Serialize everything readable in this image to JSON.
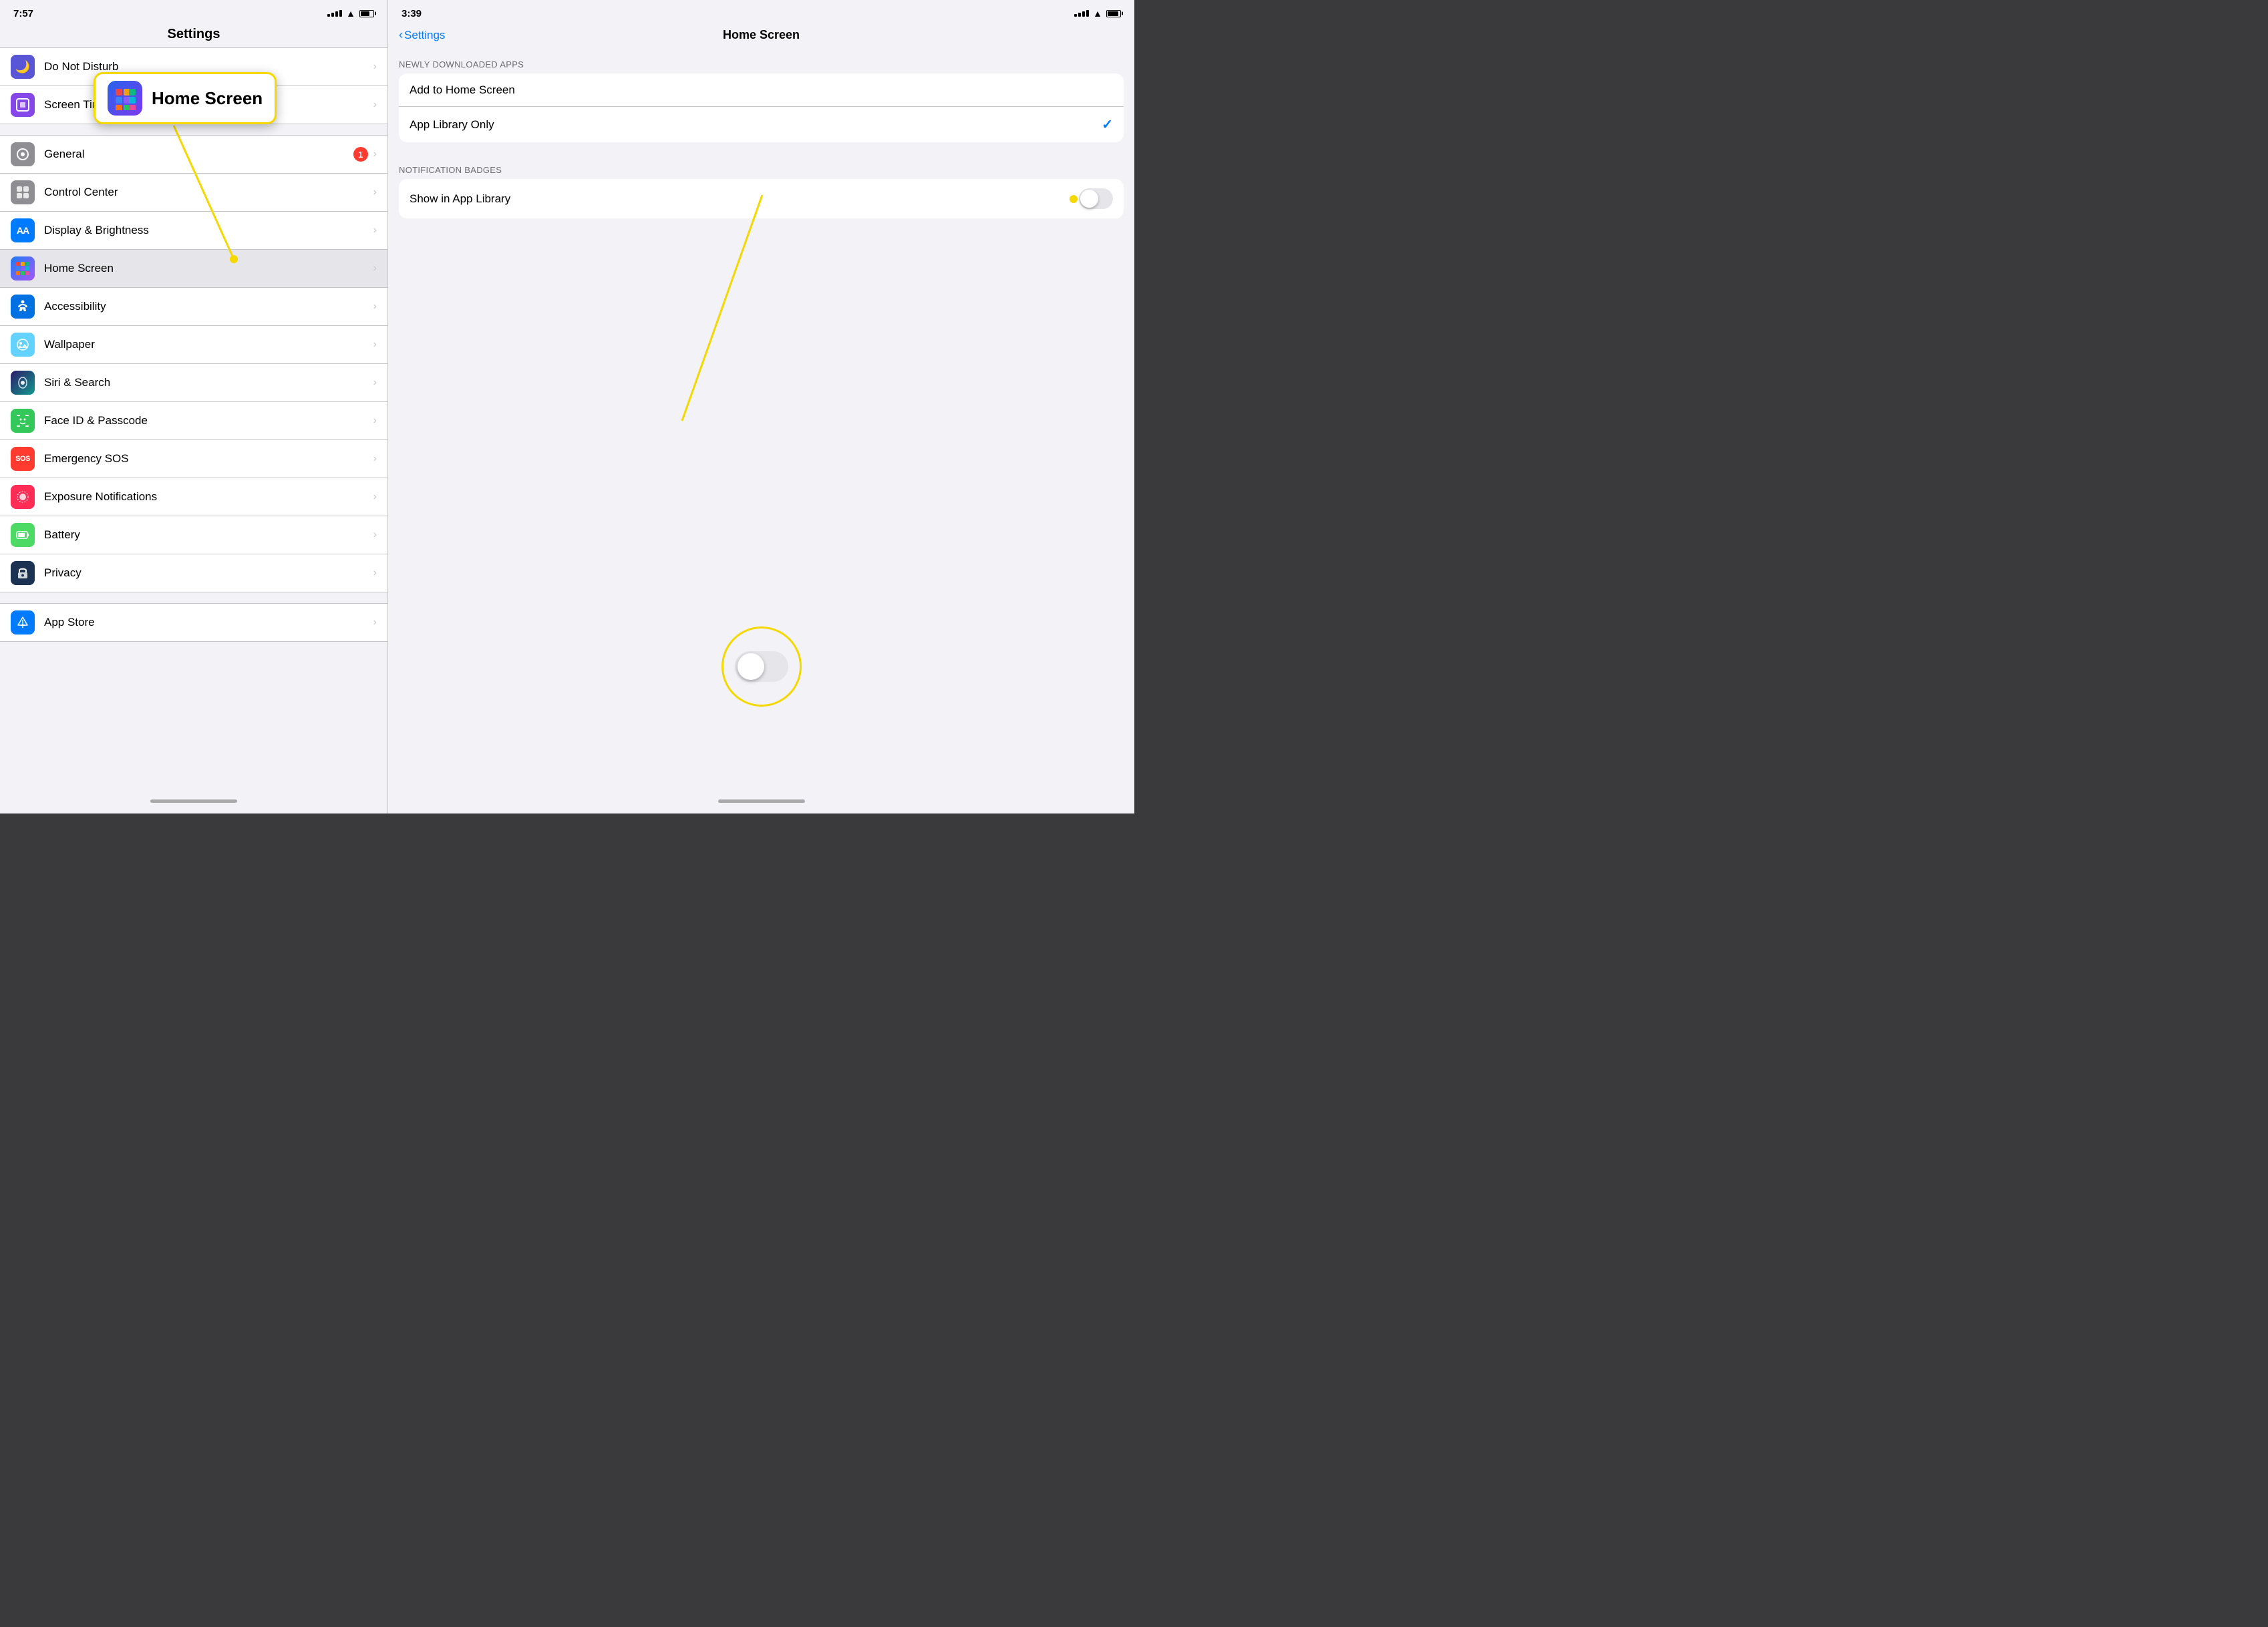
{
  "leftPanel": {
    "statusBar": {
      "time": "7:57",
      "timeIcon": "location-arrow",
      "batteryLevel": 70
    },
    "title": "Settings",
    "items": [
      {
        "id": "do-not-disturb",
        "label": "Do Not Disturb",
        "iconBg": "icon-donotdisturb",
        "iconChar": "🌙",
        "badge": null
      },
      {
        "id": "screen-time",
        "label": "Screen Time",
        "iconBg": "icon-screentime",
        "iconChar": "⏳",
        "badge": null
      },
      {
        "id": "general",
        "label": "General",
        "iconBg": "icon-general",
        "iconChar": "⚙️",
        "badge": "1"
      },
      {
        "id": "control-center",
        "label": "Control Center",
        "iconBg": "icon-controlcenter",
        "iconChar": "⊞",
        "badge": null
      },
      {
        "id": "display-brightness",
        "label": "Display & Brightness",
        "iconBg": "icon-displaybrightness",
        "iconChar": "AA",
        "badge": null
      },
      {
        "id": "home-screen",
        "label": "Home Screen",
        "iconBg": "icon-homescreen",
        "iconChar": "⊞",
        "badge": null,
        "highlighted": true
      },
      {
        "id": "accessibility",
        "label": "Accessibility",
        "iconBg": "icon-accessibility",
        "iconChar": "♿",
        "badge": null
      },
      {
        "id": "wallpaper",
        "label": "Wallpaper",
        "iconBg": "icon-wallpaper",
        "iconChar": "🖼",
        "badge": null
      },
      {
        "id": "siri-search",
        "label": "Siri & Search",
        "iconBg": "icon-siri",
        "iconChar": "◎",
        "badge": null
      },
      {
        "id": "face-id",
        "label": "Face ID & Passcode",
        "iconBg": "icon-faceid",
        "iconChar": "🙂",
        "badge": null
      },
      {
        "id": "emergency-sos",
        "label": "Emergency SOS",
        "iconBg": "icon-sos",
        "iconChar": "SOS",
        "badge": null
      },
      {
        "id": "exposure",
        "label": "Exposure Notifications",
        "iconBg": "icon-exposure",
        "iconChar": "◎",
        "badge": null
      },
      {
        "id": "battery",
        "label": "Battery",
        "iconBg": "icon-battery",
        "iconChar": "🔋",
        "badge": null
      },
      {
        "id": "privacy",
        "label": "Privacy",
        "iconBg": "icon-privacy",
        "iconChar": "✋",
        "badge": null
      }
    ],
    "items2": [
      {
        "id": "app-store",
        "label": "App Store",
        "iconBg": "icon-appstore",
        "iconChar": "A",
        "badge": null
      }
    ]
  },
  "callout": {
    "title": "Home Screen",
    "iconChar": "⊞"
  },
  "rightPanel": {
    "statusBar": {
      "time": "3:39",
      "timeIcon": "location-arrow"
    },
    "backLabel": "Settings",
    "title": "Home Screen",
    "sections": [
      {
        "header": "NEWLY DOWNLOADED APPS",
        "options": [
          {
            "id": "add-home",
            "label": "Add to Home Screen",
            "checked": false
          },
          {
            "id": "app-library-only",
            "label": "App Library Only",
            "checked": true
          }
        ]
      },
      {
        "header": "NOTIFICATION BADGES",
        "options": [
          {
            "id": "show-app-library",
            "label": "Show in App Library",
            "toggle": true,
            "enabled": false
          }
        ]
      }
    ]
  }
}
